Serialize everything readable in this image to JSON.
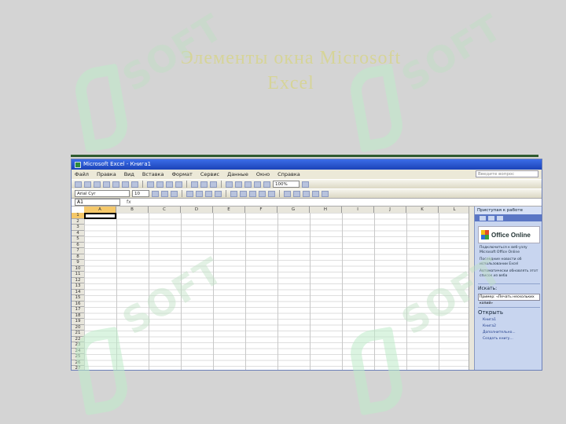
{
  "slide": {
    "title_line1": "Элементы окна Microsoft",
    "title_line2": "Excel"
  },
  "watermark": {
    "text": "SOFT"
  },
  "excel": {
    "window_title": "Microsoft Excel - Книга1",
    "menu": [
      "Файл",
      "Правка",
      "Вид",
      "Вставка",
      "Формат",
      "Сервис",
      "Данные",
      "Окно",
      "Справка"
    ],
    "help_placeholder": "Введите вопрос",
    "font_name": "Arial Cyr",
    "font_size": "10",
    "zoom": "100%",
    "name_box": "A1",
    "fx_label": "fx",
    "columns": [
      "A",
      "B",
      "C",
      "D",
      "E",
      "F",
      "G",
      "H",
      "I",
      "J",
      "K",
      "L"
    ],
    "rows": [
      "1",
      "2",
      "3",
      "4",
      "5",
      "6",
      "7",
      "8",
      "9",
      "10",
      "11",
      "12",
      "13",
      "14",
      "15",
      "16",
      "17",
      "18",
      "19",
      "20",
      "21",
      "22",
      "23",
      "24",
      "25",
      "26",
      "27"
    ],
    "taskpane": {
      "title": "Приступая к работе",
      "office_online": "Office Online",
      "links": [
        "Подключиться к веб-узлу Microsoft Office Online",
        "Последние новости об использовании Excel",
        "Автоматически обновлять этот список из веба"
      ],
      "search_label": "Искать:",
      "search_example": "Пример: «Печать нескольких копий»",
      "open_label": "Открыть",
      "files": [
        "Книга1",
        "Книга2",
        "Дополнительно..."
      ],
      "create_link": "Создать книгу..."
    }
  },
  "colors": {
    "title_bar": "#1b43b7",
    "active_header": "#f5c86a",
    "slide_bg": "#d4d4d4"
  }
}
